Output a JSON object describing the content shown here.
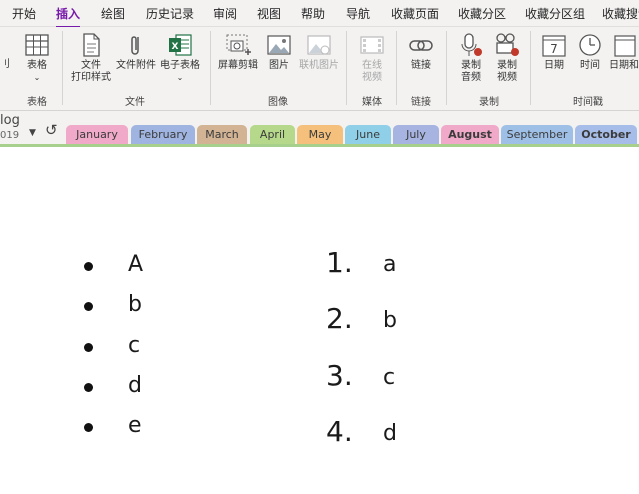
{
  "menu": [
    {
      "label": "开始",
      "active": false
    },
    {
      "label": "插入",
      "active": true
    },
    {
      "label": "绘图",
      "active": false
    },
    {
      "label": "历史记录",
      "active": false
    },
    {
      "label": "审阅",
      "active": false
    },
    {
      "label": "视图",
      "active": false
    },
    {
      "label": "帮助",
      "active": false
    },
    {
      "label": "导航",
      "active": false
    },
    {
      "label": "收藏页面",
      "active": false
    },
    {
      "label": "收藏分区",
      "active": false
    },
    {
      "label": "收藏分区组",
      "active": false
    },
    {
      "label": "收藏搜索",
      "active": false
    }
  ],
  "ribbon": {
    "table": {
      "label": "表格",
      "group": "表格"
    },
    "file_group": "文件",
    "printout": {
      "line1": "文件",
      "line2": "打印样式"
    },
    "attachment": {
      "label": "文件附件"
    },
    "spreadsheet": {
      "label": "电子表格"
    },
    "image_group": "图像",
    "screenclip": {
      "label": "屏幕剪辑"
    },
    "picture": {
      "label": "图片"
    },
    "online_picture": {
      "label": "联机图片"
    },
    "media_group": "媒体",
    "online_video": {
      "line1": "在线",
      "line2": "视频"
    },
    "link_group": "链接",
    "link": {
      "label": "链接"
    },
    "record_group": "录制",
    "record_audio": {
      "line1": "录制",
      "line2": "音频"
    },
    "record_video": {
      "line1": "录制",
      "line2": "视频"
    },
    "time_group": "时间戳",
    "date": {
      "label": "日期",
      "day": "7"
    },
    "time": {
      "label": "时间"
    },
    "datetime": {
      "label": "日期和"
    },
    "left_cut": "刂"
  },
  "notebook": {
    "name": "log",
    "sub": "019",
    "undo": "↺"
  },
  "sections": [
    {
      "label": "January",
      "color": "#f0a9c8",
      "bold": false
    },
    {
      "label": "February",
      "color": "#9fb4e0",
      "bold": false
    },
    {
      "label": "March",
      "color": "#d2b394",
      "bold": false
    },
    {
      "label": "April",
      "color": "#b5d88a",
      "bold": false
    },
    {
      "label": "May",
      "color": "#f4c07c",
      "bold": false
    },
    {
      "label": "June",
      "color": "#8fd0e8",
      "bold": false
    },
    {
      "label": "July",
      "color": "#a7b4e2",
      "bold": false
    },
    {
      "label": "August",
      "color": "#f0a9c8",
      "bold": true
    },
    {
      "label": "September",
      "color": "#9fc0e6",
      "bold": false
    },
    {
      "label": "October",
      "color": "#a7bde9",
      "bold": true
    }
  ],
  "content": {
    "bullets": [
      "A",
      "b",
      "c",
      "d",
      "e"
    ],
    "numbered": [
      {
        "label": "1.",
        "text": "a"
      },
      {
        "label": "2.",
        "text": "b"
      },
      {
        "label": "3.",
        "text": "c"
      },
      {
        "label": "4.",
        "text": "d"
      }
    ]
  }
}
